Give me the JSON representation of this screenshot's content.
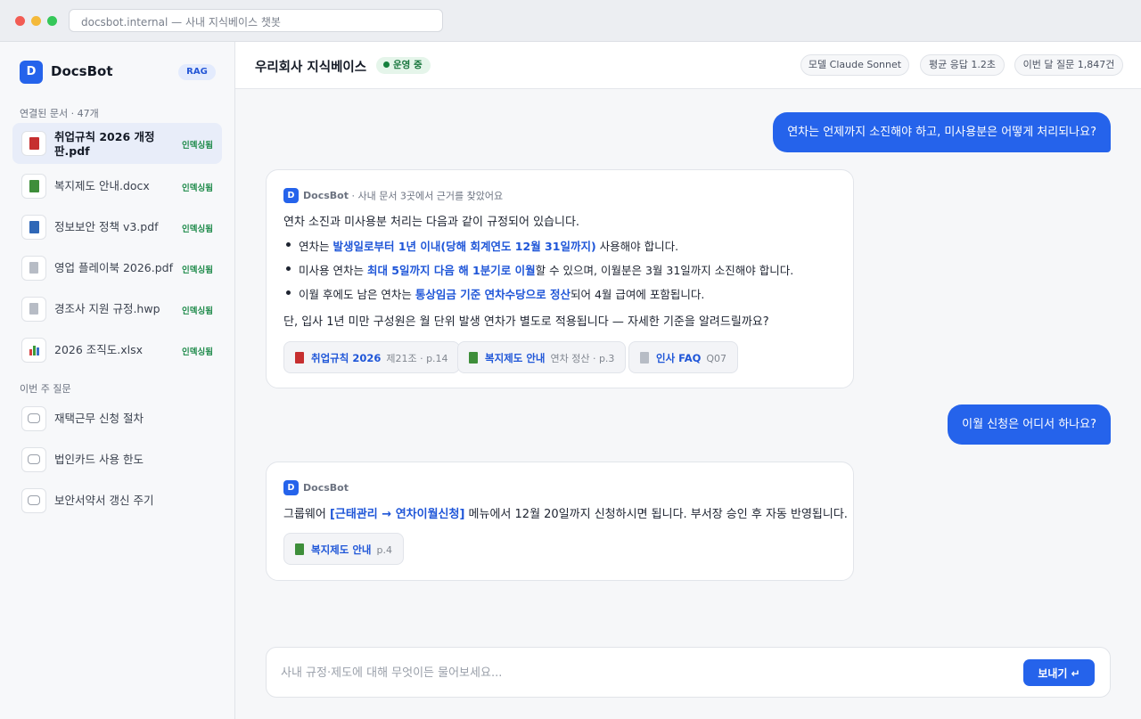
{
  "browser": {
    "url": "docsbot.internal — 사내 지식베이스 챗봇"
  },
  "sidebar": {
    "brand_letter": "D",
    "brand_name": "DocsBot",
    "brand_badge": "RAG",
    "docs_title": "연결된 문서 · 47개",
    "docs": [
      {
        "name": "취업규칙 2026 개정판.pdf",
        "status": "인덱싱됨",
        "icon": "pdf-red"
      },
      {
        "name": "복지제도 안내.docx",
        "status": "인덱싱됨",
        "icon": "book-green"
      },
      {
        "name": "정보보안 정책 v3.pdf",
        "status": "인덱싱됨",
        "icon": "book-blue"
      },
      {
        "name": "영업 플레이북 2026.pdf",
        "status": "인덱싱됨",
        "icon": "file-gray"
      },
      {
        "name": "경조사 지원 규정.hwp",
        "status": "인덱싱됨",
        "icon": "file-gray"
      },
      {
        "name": "2026 조직도.xlsx",
        "status": "인덱싱됨",
        "icon": "chart"
      }
    ],
    "questions_title": "이번 주 질문",
    "questions": [
      {
        "label": "재택근무 신청 절차"
      },
      {
        "label": "법인카드 사용 한도"
      },
      {
        "label": "보안서약서 갱신 주기"
      }
    ]
  },
  "header": {
    "title": "우리회사 지식베이스",
    "status": "운영 중",
    "chips": [
      "모델 Claude Sonnet",
      "평균 응답 1.2초",
      "이번 달 질문 1,847건"
    ]
  },
  "chat": {
    "q1": "연차는 언제까지 소진해야 하고, 미사용분은 어떻게 처리되나요?",
    "a1": {
      "bot_name": "DocsBot",
      "source_note": " · 사내 문서 3곳에서 근거를 찾았어요",
      "intro": "연차 소진과 미사용분 처리는 다음과 같이 규정되어 있습니다.",
      "b1_pre": "연차는 ",
      "b1_hl": "발생일로부터 1년 이내(당해 회계연도 12월 31일까지)",
      "b1_post": " 사용해야 합니다.",
      "b2_pre": "미사용 연차는 ",
      "b2_hl": "최대 5일까지 다음 해 1분기로 이월",
      "b2_post": "할 수 있으며, 이월분은 3월 31일까지 소진해야 합니다.",
      "b3_pre": "이월 후에도 남은 연차는 ",
      "b3_hl": "통상임금 기준 연차수당으로 정산",
      "b3_post": "되어 4월 급여에 포함됩니다.",
      "outro": "단, 입사 1년 미만 구성원은 월 단위 발생 연차가 별도로 적용됩니다 — 자세한 기준을 알려드릴까요?",
      "citations": [
        {
          "title": "취업규칙 2026",
          "loc": "제21조 · p.14",
          "color": "red"
        },
        {
          "title": "복지제도 안내",
          "loc": "연차 정산 · p.3",
          "color": "green"
        },
        {
          "title": "인사 FAQ",
          "loc": "Q07",
          "color": "gray"
        }
      ]
    },
    "q2": "이월 신청은 어디서 하나요?",
    "a2": {
      "bot_name": "DocsBot",
      "pre": "그룹웨어 ",
      "hl": "[근태관리 → 연차이월신청]",
      "post": " 메뉴에서 12월 20일까지 신청하시면 됩니다. 부서장 승인 후 자동 반영됩니다.",
      "citations": [
        {
          "title": "복지제도 안내",
          "loc": "p.4",
          "color": "green"
        }
      ]
    }
  },
  "composer": {
    "placeholder": "사내 규정·제도에 대해 무엇이든 물어보세요...",
    "send_label": "보내기 ↵"
  }
}
